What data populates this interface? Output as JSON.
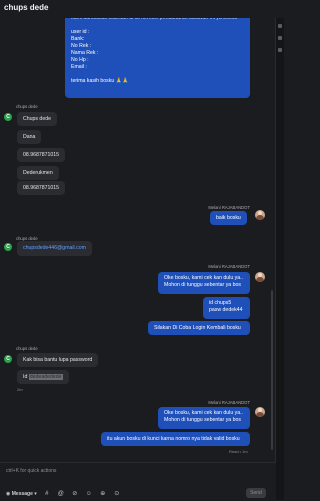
{
  "header": {
    "title": "chups dede"
  },
  "messages": {
    "top_bubble": {
      "cut_line": "kami dahulukan silahkan di isi formolir pendaftaran dibawah ini ya bosku",
      "lines": [
        "user id :",
        "Bank:",
        "No Rek :",
        "Nama Rek :",
        "No Hp :",
        "Email :"
      ],
      "closing": "terima kasih bosku 🙏🙏"
    },
    "group1": {
      "name": "chups dede",
      "avatar": "C",
      "items": [
        "Chups dede",
        "Dana",
        "08.9687871015",
        "Dederukmen",
        "08.9687871015"
      ]
    },
    "group2": {
      "name": "Melani RAJABANDOT",
      "items": [
        "baik bosku"
      ]
    },
    "group3": {
      "name": "chups dede",
      "avatar": "C",
      "link": "chupsdede446@gmail.com"
    },
    "group4": {
      "name": "Melani RAJABANDOT",
      "bubble1": [
        "Oke bosku, kami cek kan dulu ya..",
        "Mohon di tunggu sebentar ya bos"
      ],
      "bubble2": [
        "id chups5",
        "pasw dedek44"
      ],
      "bubble3": "Silakan Di Coba Login Kembali bosku"
    },
    "group5": {
      "name": "chups dede",
      "avatar": "C",
      "bubble1": "Kak bisa bantu lupa password",
      "bubble2_prefix": "Id",
      "bubble2_value": "dedeadedede",
      "time": "2m"
    },
    "group6": {
      "name": "Melani RAJABANDOT",
      "bubble1": [
        "Oke bosku, kami cek kan dulu ya..",
        "Mohon di tunggu sebentar ya bos"
      ],
      "bubble2": "itu akun bosku di kunci karna nomro nya tidak valid bosku",
      "read": "Read • 1m"
    }
  },
  "composer": {
    "placeholder": "ctrl+K for quick actions",
    "message_label": "Message",
    "tools": [
      "#",
      "@",
      "⊘",
      "☺",
      "⊕",
      "⊙"
    ],
    "send_label": "Send"
  },
  "colors": {
    "bubble_blue": "#1f4fb8",
    "bubble_gray": "#2b2c31",
    "avatar_green": "#2e9e4f",
    "link": "#5ea0ff"
  }
}
